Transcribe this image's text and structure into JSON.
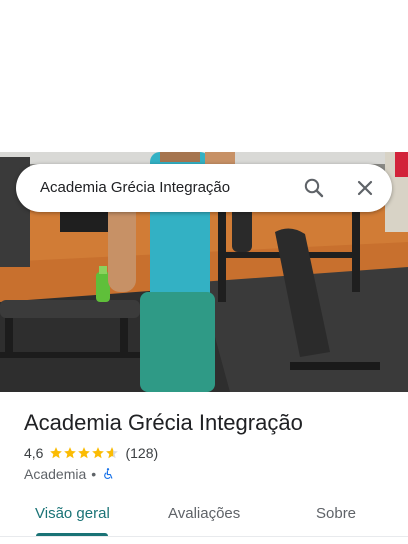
{
  "search": {
    "query": "Academia Grécia Integração"
  },
  "place": {
    "title": "Academia Grécia Integração",
    "rating": "4,6",
    "stars": 4.6,
    "reviews_count": "(128)",
    "category": "Academia",
    "separator": "•"
  },
  "tabs": [
    {
      "label": "Visão geral",
      "active": true
    },
    {
      "label": "Avaliações",
      "active": false
    },
    {
      "label": "Sobre",
      "active": false
    }
  ],
  "colors": {
    "accent": "#1a7376",
    "star": "#fbbc04",
    "accessibility": "#1a73e8"
  }
}
